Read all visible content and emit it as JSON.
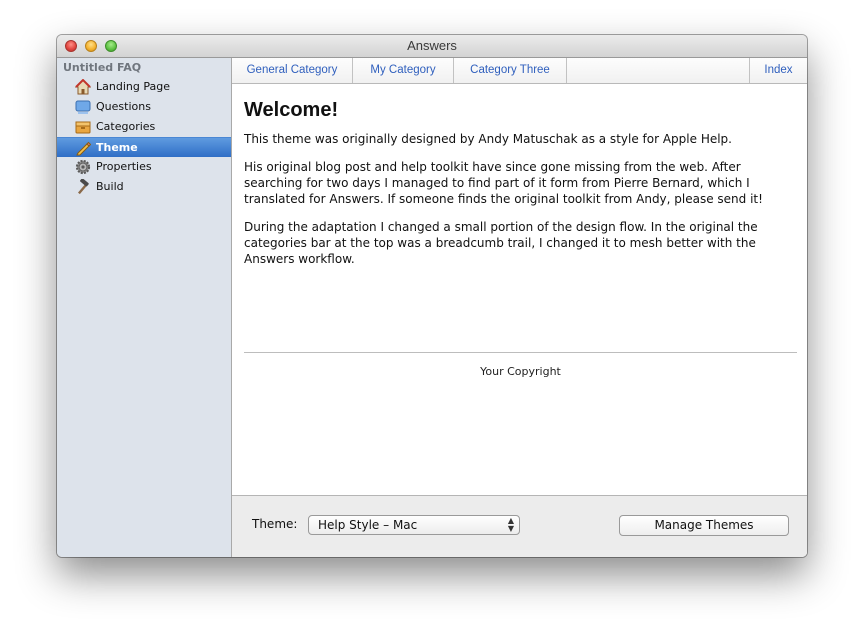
{
  "window": {
    "title": "Answers"
  },
  "sidebar": {
    "header": "Untitled FAQ",
    "items": [
      {
        "label": "Landing Page",
        "icon": "house-icon"
      },
      {
        "label": "Questions",
        "icon": "questions-icon"
      },
      {
        "label": "Categories",
        "icon": "box-icon"
      },
      {
        "label": "Theme",
        "icon": "pencil-icon",
        "selected": true
      },
      {
        "label": "Properties",
        "icon": "gear-icon"
      },
      {
        "label": "Build",
        "icon": "hammer-icon"
      }
    ]
  },
  "tabs": [
    {
      "label": "General Category"
    },
    {
      "label": "My Category"
    },
    {
      "label": "Category Three"
    }
  ],
  "index_tab": "Index",
  "preview": {
    "heading": "Welcome!",
    "paragraphs": [
      "This theme was originally designed by Andy Matuschak as a style for Apple Help.",
      "His original blog post and help toolkit have since gone missing from the web. After searching for two days I managed to find part of it form from Pierre Bernard, which I translated for Answers. If someone finds the original toolkit from Andy, please send it!",
      "During the adaptation I changed a small portion of the design flow. In the original the categories bar at the top was a breadcumb trail, I changed it to mesh better with the Answers workflow."
    ],
    "copyright": "Your Copyright"
  },
  "footer": {
    "theme_label": "Theme:",
    "theme_value": "Help Style – Mac",
    "manage_button": "Manage Themes"
  },
  "colors": {
    "selection": "#3a7bd5",
    "tab_link": "#2f5fbd",
    "sidebar_bg": "#dde3eb"
  }
}
